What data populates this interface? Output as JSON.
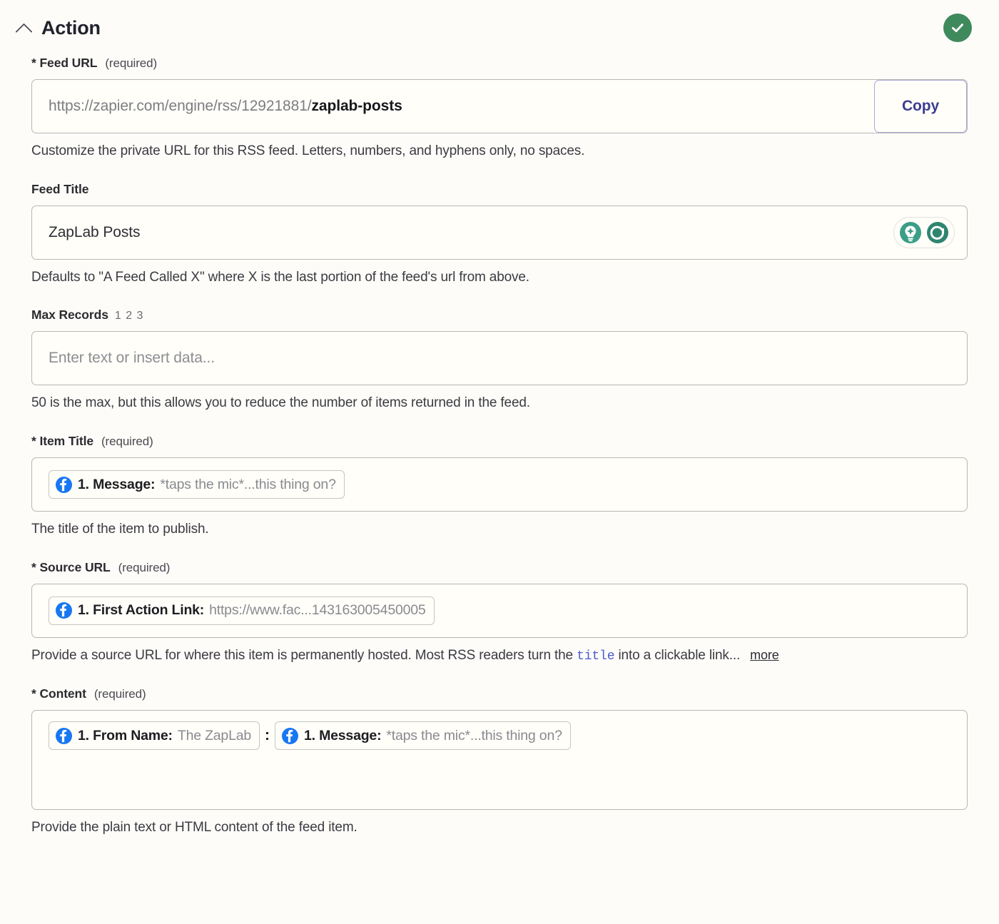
{
  "header": {
    "title": "Action",
    "collapse_icon": "chevron-up-icon",
    "status_icon": "check-circle-icon",
    "status_color": "#3f8a5c"
  },
  "fields": {
    "feed_url": {
      "label": "* Feed URL",
      "required_note": "(required)",
      "value_prefix": "https://zapier.com/engine/rss/12921881/",
      "value_slug": "zaplab-posts",
      "copy_label": "Copy",
      "copy_color": "#3c3c91",
      "help": "Customize the private URL for this RSS feed. Letters, numbers, and hyphens only, no spaces."
    },
    "feed_title": {
      "label": "Feed Title",
      "value": "ZapLab Posts",
      "icons": [
        "lightbulb-ai-icon",
        "refresh-circle-icon"
      ],
      "icon_color": "#3b9e86",
      "help": "Defaults to \"A Feed Called X\" where X is the last portion of the feed's url from above."
    },
    "max_records": {
      "label": "Max Records",
      "steps": "1 2 3",
      "placeholder": "Enter text or insert data...",
      "value": "",
      "help": "50 is the max, but this allows you to reduce the number of items returned in the feed."
    },
    "item_title": {
      "label": "* Item Title",
      "required_note": "(required)",
      "tokens": [
        {
          "app": "facebook-icon",
          "key": "1. Message:",
          "value": "*taps the mic*...this thing on?"
        }
      ],
      "help": "The title of the item to publish."
    },
    "source_url": {
      "label": "* Source URL",
      "required_note": "(required)",
      "tokens": [
        {
          "app": "facebook-icon",
          "key": "1. First Action Link:",
          "value": "https://www.fac...143163005450005"
        }
      ],
      "help_part1": "Provide a source URL for where this item is permanently hosted. Most RSS readers turn the ",
      "help_code": "title",
      "help_part2": " into a clickable link...",
      "more_label": "more"
    },
    "content": {
      "label": "* Content",
      "required_note": "(required)",
      "tokens": [
        {
          "app": "facebook-icon",
          "key": "1. From Name:",
          "value": "The ZapLab"
        },
        {
          "app": "facebook-icon",
          "key": "1. Message:",
          "value": "*taps the mic*...this thing on?"
        }
      ],
      "separator": ":",
      "help": "Provide the plain text or HTML content of the feed item."
    }
  }
}
